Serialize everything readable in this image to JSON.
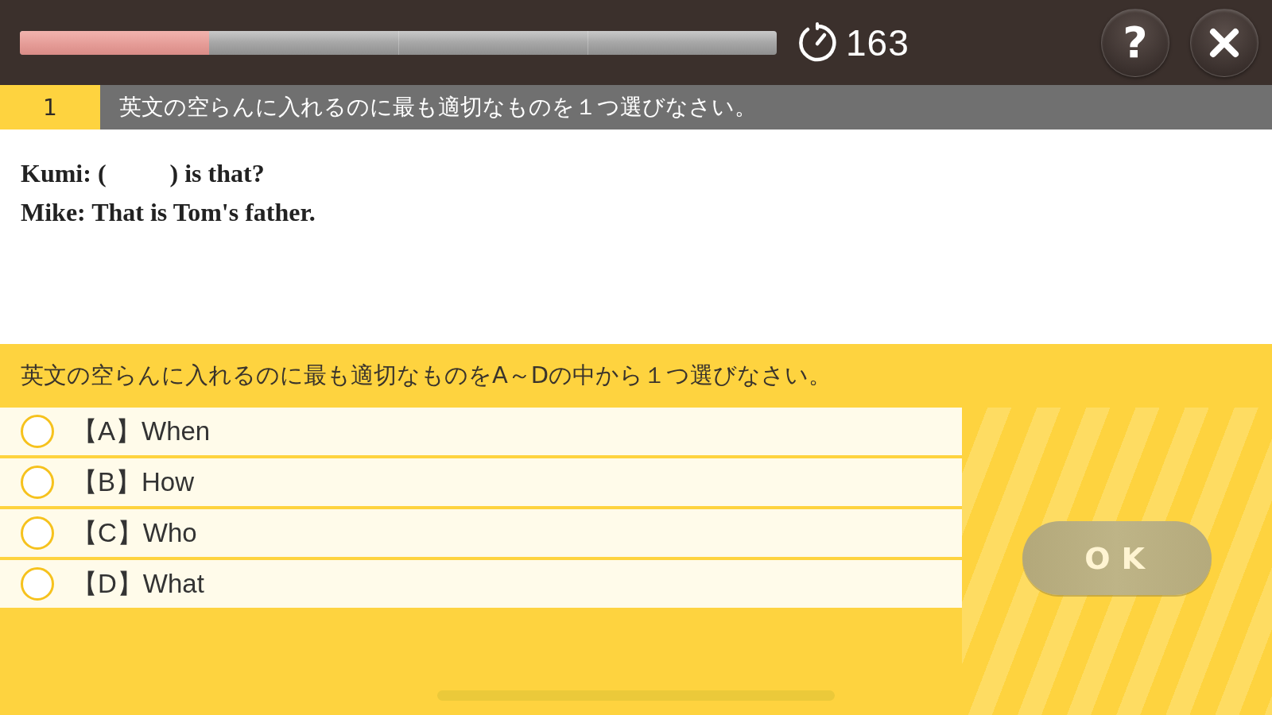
{
  "top_bar": {
    "progress": {
      "level": 0.25
    },
    "timer": {
      "value": "163"
    },
    "help_button": {
      "label": "?"
    }
  },
  "question_header": {
    "number": "1",
    "prompt": "英文の空らんに入れるのに最も適切なものを１つ選びなさい。"
  },
  "passage": {
    "lines": [
      "Kumi: (          ) is that?",
      "Mike: That is Tom's father."
    ]
  },
  "answer_area": {
    "instruction": "英文の空らんに入れるのに最も適切なものをA～Dの中から１つ選びなさい。",
    "options": [
      {
        "label": "【A】When",
        "selected": false
      },
      {
        "label": "【B】How",
        "selected": false
      },
      {
        "label": "【C】Who",
        "selected": false
      },
      {
        "label": "【D】What",
        "selected": false
      }
    ],
    "ok_button": {
      "label": "OK",
      "disabled": true
    }
  }
}
